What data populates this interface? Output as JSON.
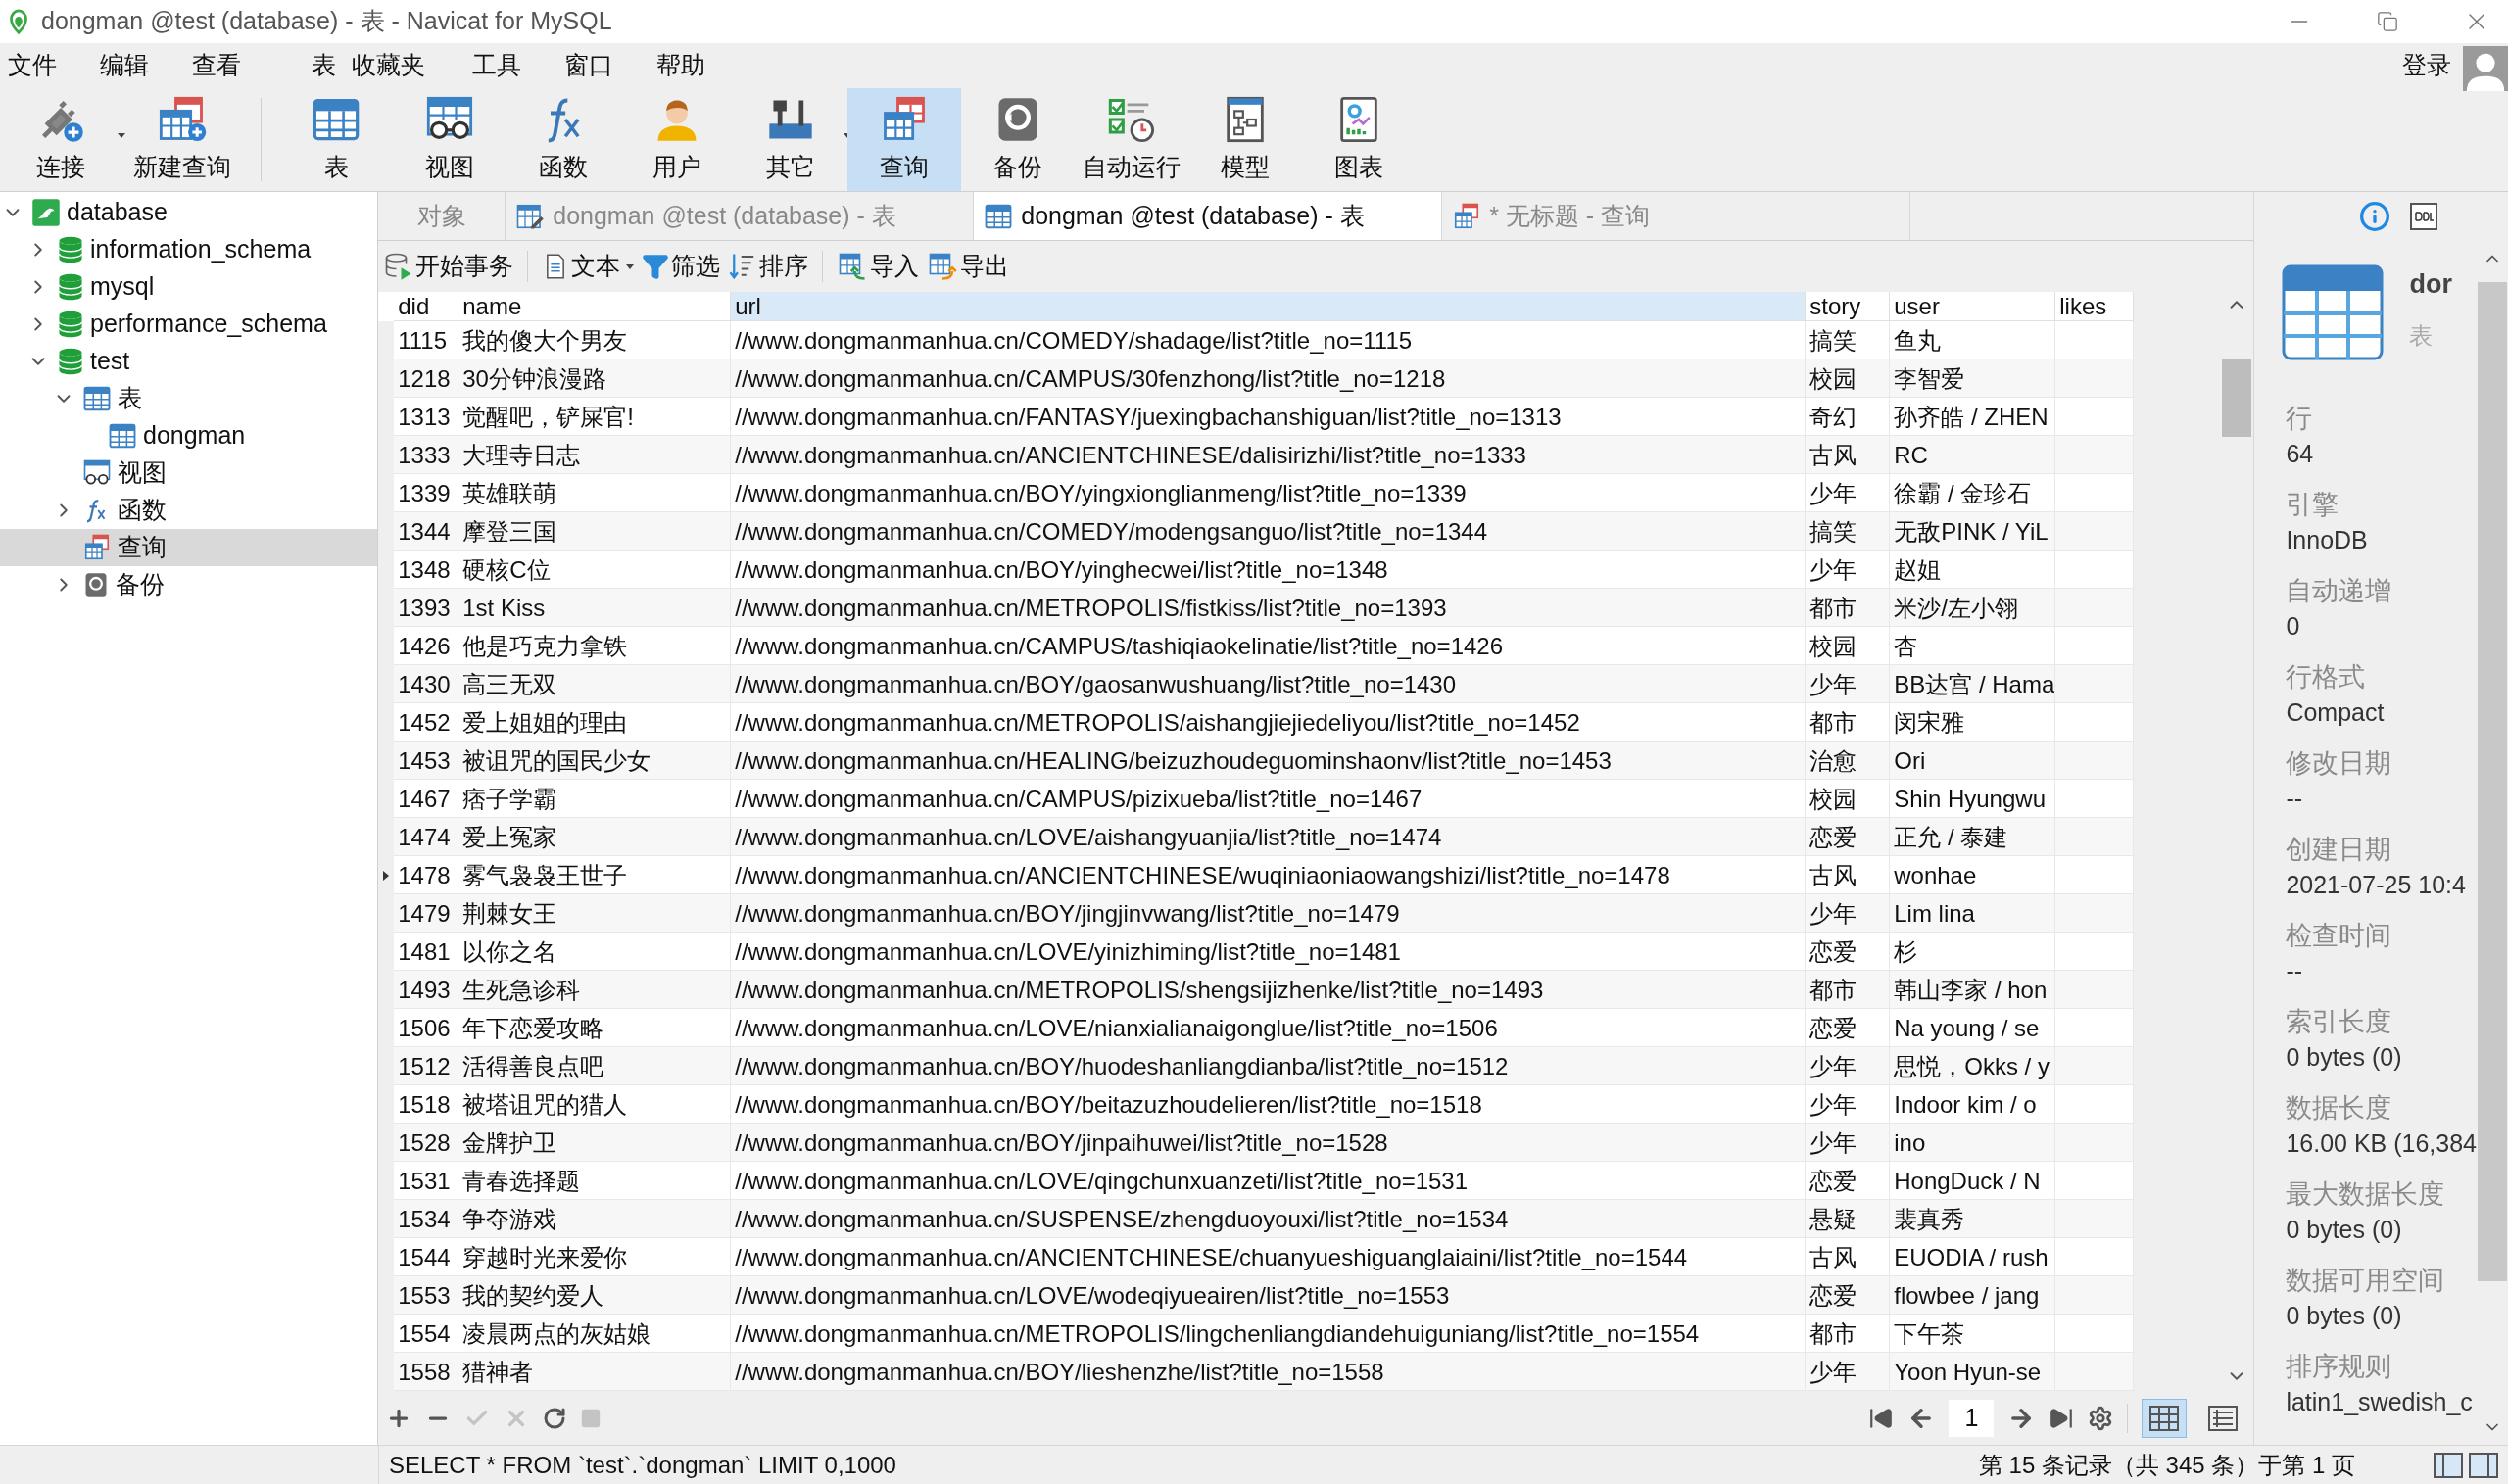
{
  "window": {
    "title": "dongman @test (database) - 表 - Navicat for MySQL"
  },
  "menu": [
    "文件",
    "编辑",
    "查看",
    "表",
    "收藏夹",
    "工具",
    "窗口",
    "帮助"
  ],
  "account": {
    "label": "登录"
  },
  "toolbar": [
    {
      "label": "连接",
      "kind": "connect",
      "dropdown": true,
      "selected": false
    },
    {
      "label": "新建查询",
      "kind": "newquery",
      "dropdown": false,
      "selected": false
    },
    {
      "label": "表",
      "kind": "table",
      "dropdown": false,
      "selected": false
    },
    {
      "label": "视图",
      "kind": "view",
      "dropdown": false,
      "selected": false
    },
    {
      "label": "函数",
      "kind": "function",
      "dropdown": false,
      "selected": false
    },
    {
      "label": "用户",
      "kind": "user",
      "dropdown": false,
      "selected": false
    },
    {
      "label": "其它",
      "kind": "tools",
      "dropdown": true,
      "selected": false
    },
    {
      "label": "查询",
      "kind": "query",
      "dropdown": false,
      "selected": true
    },
    {
      "label": "备份",
      "kind": "backup",
      "dropdown": false,
      "selected": false
    },
    {
      "label": "自动运行",
      "kind": "schedule",
      "dropdown": false,
      "selected": false
    },
    {
      "label": "模型",
      "kind": "model",
      "dropdown": false,
      "selected": false
    },
    {
      "label": "图表",
      "kind": "chart",
      "dropdown": false,
      "selected": false
    }
  ],
  "sidebar": {
    "tree": [
      {
        "label": "database",
        "kind": "connection",
        "expanded": true,
        "selected": false,
        "children": [
          {
            "label": "information_schema",
            "kind": "db",
            "expanded": false,
            "selected": false
          },
          {
            "label": "mysql",
            "kind": "db",
            "expanded": false,
            "selected": false
          },
          {
            "label": "performance_schema",
            "kind": "db",
            "expanded": false,
            "selected": false
          },
          {
            "label": "test",
            "kind": "db",
            "expanded": true,
            "selected": false,
            "children": [
              {
                "label": "表",
                "kind": "table",
                "expanded": true,
                "selected": false,
                "children": [
                  {
                    "label": "dongman",
                    "kind": "table",
                    "selected": false
                  }
                ]
              },
              {
                "label": "视图",
                "kind": "view",
                "selected": false
              },
              {
                "label": "函数",
                "kind": "function",
                "expanded": false,
                "selected": false
              },
              {
                "label": "查询",
                "kind": "query",
                "selected": true
              },
              {
                "label": "备份",
                "kind": "backup",
                "expanded": false,
                "selected": false
              }
            ]
          }
        ]
      }
    ]
  },
  "tabs": [
    {
      "label": "对象",
      "kind": "plain",
      "selected": false
    },
    {
      "label": "dongman @test (database) - 表",
      "kind": "design",
      "selected": false
    },
    {
      "label": "dongman @test (database) - 表",
      "kind": "table",
      "selected": true
    },
    {
      "label": "* 无标题 - 查询",
      "kind": "query",
      "selected": false
    }
  ],
  "actions": [
    {
      "label": "开始事务",
      "kind": "transaction",
      "dropdown": false
    },
    {
      "label": "文本",
      "kind": "text",
      "dropdown": true
    },
    {
      "label": "筛选",
      "kind": "filter",
      "dropdown": false
    },
    {
      "label": "排序",
      "kind": "sort",
      "dropdown": false
    },
    {
      "label": "导入",
      "kind": "import",
      "dropdown": false
    },
    {
      "label": "导出",
      "kind": "export",
      "dropdown": false
    }
  ],
  "table": {
    "columns": [
      {
        "label": "did",
        "selected": false
      },
      {
        "label": "name",
        "selected": false
      },
      {
        "label": "url",
        "selected": true
      },
      {
        "label": "story",
        "selected": false
      },
      {
        "label": "user",
        "selected": false
      },
      {
        "label": "likes",
        "selected": false
      }
    ],
    "rows": [
      {
        "selected": false,
        "cells": [
          "1115",
          "我的傻大个男友",
          "//www.dongmanmanhua.cn/COMEDY/shadage/list?title_no=1115",
          "搞笑",
          "鱼丸"
        ]
      },
      {
        "selected": false,
        "cells": [
          "1218",
          "30分钟浪漫路",
          "//www.dongmanmanhua.cn/CAMPUS/30fenzhong/list?title_no=1218",
          "校园",
          "李智爱"
        ]
      },
      {
        "selected": false,
        "cells": [
          "1313",
          "觉醒吧，铲屎官!",
          "//www.dongmanmanhua.cn/FANTASY/juexingbachanshiguan/list?title_no=1313",
          "奇幻",
          "孙齐皓 / ZHEN"
        ]
      },
      {
        "selected": false,
        "cells": [
          "1333",
          "大理寺日志",
          "//www.dongmanmanhua.cn/ANCIENTCHINESE/dalisirizhi/list?title_no=1333",
          "古风",
          "RC"
        ]
      },
      {
        "selected": false,
        "cells": [
          "1339",
          "英雄联萌",
          "//www.dongmanmanhua.cn/BOY/yingxionglianmeng/list?title_no=1339",
          "少年",
          "徐霸 / 金珍石"
        ]
      },
      {
        "selected": false,
        "cells": [
          "1344",
          "摩登三国",
          "//www.dongmanmanhua.cn/COMEDY/modengsanguo/list?title_no=1344",
          "搞笑",
          "无敌PINK / YiL"
        ]
      },
      {
        "selected": false,
        "cells": [
          "1348",
          "硬核C位",
          "//www.dongmanmanhua.cn/BOY/yinghecwei/list?title_no=1348",
          "少年",
          "赵姐"
        ]
      },
      {
        "selected": false,
        "cells": [
          "1393",
          "1st Kiss",
          "//www.dongmanmanhua.cn/METROPOLIS/fistkiss/list?title_no=1393",
          "都市",
          "米沙/左小翎"
        ]
      },
      {
        "selected": false,
        "cells": [
          "1426",
          "他是巧克力拿铁",
          "//www.dongmanmanhua.cn/CAMPUS/tashiqiaokelinatie/list?title_no=1426",
          "校园",
          "杏"
        ]
      },
      {
        "selected": false,
        "cells": [
          "1430",
          "高三无双",
          "//www.dongmanmanhua.cn/BOY/gaosanwushuang/list?title_no=1430",
          "少年",
          "BB达宫 / Hama"
        ]
      },
      {
        "selected": false,
        "cells": [
          "1452",
          "爱上姐姐的理由",
          "//www.dongmanmanhua.cn/METROPOLIS/aishangjiejiedeliyou/list?title_no=1452",
          "都市",
          "闵宋雅"
        ]
      },
      {
        "selected": false,
        "cells": [
          "1453",
          "被诅咒的国民少女",
          "//www.dongmanmanhua.cn/HEALING/beizuzhoudeguominshaonv/list?title_no=1453",
          "治愈",
          "Ori"
        ]
      },
      {
        "selected": false,
        "cells": [
          "1467",
          "痞子学霸",
          "//www.dongmanmanhua.cn/CAMPUS/pizixueba/list?title_no=1467",
          "校园",
          "Shin Hyungwu"
        ]
      },
      {
        "selected": false,
        "cells": [
          "1474",
          "爱上冤家",
          "//www.dongmanmanhua.cn/LOVE/aishangyuanjia/list?title_no=1474",
          "恋爱",
          "正允 / 泰建"
        ]
      },
      {
        "selected": true,
        "cells": [
          "1478",
          "雾气袅袅王世子",
          "//www.dongmanmanhua.cn/ANCIENTCHINESE/wuqiniaoniaowangshizi/list?title_no=1478",
          "古风",
          "wonhae"
        ]
      },
      {
        "selected": false,
        "cells": [
          "1479",
          "荆棘女王",
          "//www.dongmanmanhua.cn/BOY/jingjinvwang/list?title_no=1479",
          "少年",
          "Lim lina"
        ]
      },
      {
        "selected": false,
        "cells": [
          "1481",
          "以你之名",
          "//www.dongmanmanhua.cn/LOVE/yinizhiming/list?title_no=1481",
          "恋爱",
          "杉"
        ]
      },
      {
        "selected": false,
        "cells": [
          "1493",
          "生死急诊科",
          "//www.dongmanmanhua.cn/METROPOLIS/shengsijizhenke/list?title_no=1493",
          "都市",
          "韩山李家 / hon"
        ]
      },
      {
        "selected": false,
        "cells": [
          "1506",
          "年下恋爱攻略",
          "//www.dongmanmanhua.cn/LOVE/nianxialianaigonglue/list?title_no=1506",
          "恋爱",
          "Na young / se"
        ]
      },
      {
        "selected": false,
        "cells": [
          "1512",
          "活得善良点吧",
          "//www.dongmanmanhua.cn/BOY/huodeshanliangdianba/list?title_no=1512",
          "少年",
          "思悦，Okks / y"
        ]
      },
      {
        "selected": false,
        "cells": [
          "1518",
          "被塔诅咒的猎人",
          "//www.dongmanmanhua.cn/BOY/beitazuzhoudelieren/list?title_no=1518",
          "少年",
          "Indoor kim / o"
        ]
      },
      {
        "selected": false,
        "cells": [
          "1528",
          "金牌护卫",
          "//www.dongmanmanhua.cn/BOY/jinpaihuwei/list?title_no=1528",
          "少年",
          "ino"
        ]
      },
      {
        "selected": false,
        "cells": [
          "1531",
          "青春选择题",
          "//www.dongmanmanhua.cn/LOVE/qingchunxuanzeti/list?title_no=1531",
          "恋爱",
          "HongDuck / N"
        ]
      },
      {
        "selected": false,
        "cells": [
          "1534",
          "争夺游戏",
          "//www.dongmanmanhua.cn/SUSPENSE/zhengduoyouxi/list?title_no=1534",
          "悬疑",
          "裴真秀"
        ]
      },
      {
        "selected": false,
        "cells": [
          "1544",
          "穿越时光来爱你",
          "//www.dongmanmanhua.cn/ANCIENTCHINESE/chuanyueshiguanglaiaini/list?title_no=1544",
          "古风",
          "EUODIA / rush"
        ]
      },
      {
        "selected": false,
        "cells": [
          "1553",
          "我的契约爱人",
          "//www.dongmanmanhua.cn/LOVE/wodeqiyueairen/list?title_no=1553",
          "恋爱",
          "flowbee / jang"
        ]
      },
      {
        "selected": false,
        "cells": [
          "1554",
          "凌晨两点的灰姑娘",
          "//www.dongmanmanhua.cn/METROPOLIS/lingchenliangdiandehuiguniang/list?title_no=1554",
          "都市",
          "下午茶"
        ]
      },
      {
        "selected": false,
        "cells": [
          "1558",
          "猎神者",
          "//www.dongmanmanhua.cn/BOY/lieshenzhe/list?title_no=1558",
          "少年",
          "Yoon Hyun-se"
        ]
      }
    ]
  },
  "pager": {
    "page": "1",
    "views": [
      {
        "kind": "grid",
        "selected": true
      },
      {
        "kind": "form",
        "selected": false
      }
    ]
  },
  "info": {
    "name": "dor",
    "type": "表",
    "properties": [
      {
        "label": "行",
        "value": "64"
      },
      {
        "label": "引擎",
        "value": "InnoDB"
      },
      {
        "label": "自动递增",
        "value": "0"
      },
      {
        "label": "行格式",
        "value": "Compact"
      },
      {
        "label": "修改日期",
        "value": "--"
      },
      {
        "label": "创建日期",
        "value": "2021-07-25 10:4"
      },
      {
        "label": "检查时间",
        "value": "--"
      },
      {
        "label": "索引长度",
        "value": "0 bytes (0)"
      },
      {
        "label": "数据长度",
        "value": "16.00 KB (16,384"
      },
      {
        "label": "最大数据长度",
        "value": "0 bytes (0)"
      },
      {
        "label": "数据可用空间",
        "value": "0 bytes (0)"
      },
      {
        "label": "排序规则",
        "value": "latin1_swedish_c"
      }
    ]
  },
  "status_bar": {
    "sql": "SELECT * FROM `test`.`dongman` LIMIT 0,1000",
    "record": "第 15 条记录（共 345 条）于第 1 页"
  }
}
